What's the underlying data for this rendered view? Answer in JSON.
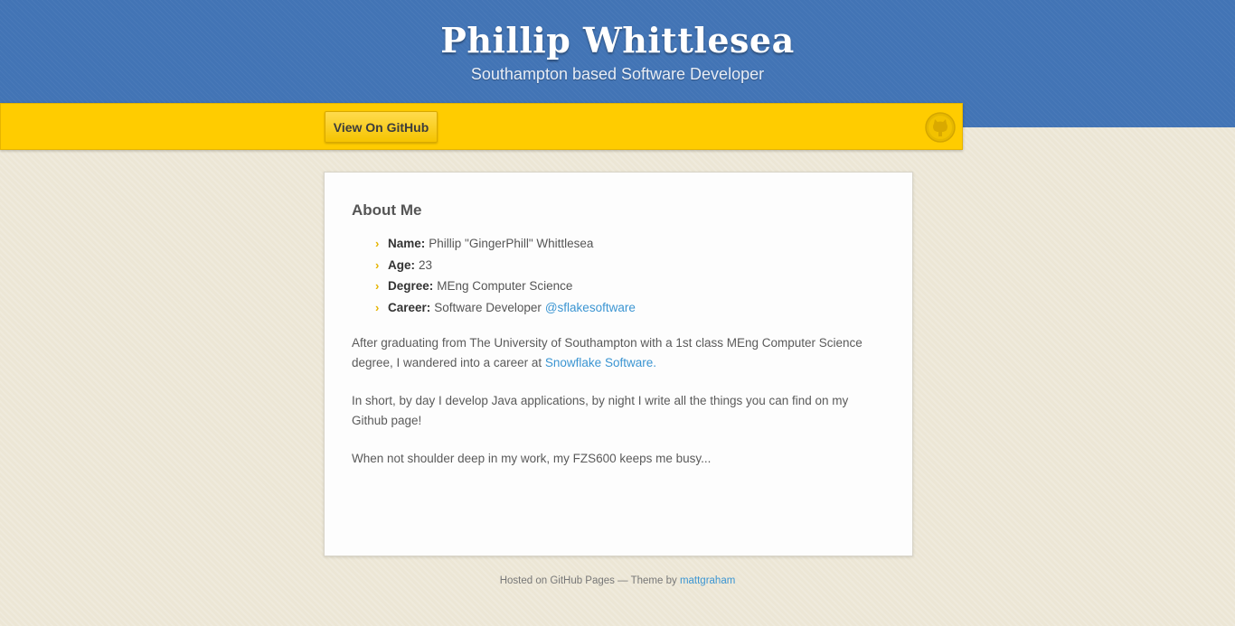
{
  "header": {
    "title": "Phillip Whittlesea",
    "subtitle": "Southampton based Software Developer"
  },
  "toolbar": {
    "github_button_label": "View On GitHub",
    "icon": "github-octocat-icon"
  },
  "about": {
    "heading": "About Me",
    "facts": [
      {
        "label": "Name:",
        "value": "Phillip \"GingerPhill\" Whittlesea"
      },
      {
        "label": "Age:",
        "value": "23"
      },
      {
        "label": "Degree:",
        "value": "MEng Computer Science"
      },
      {
        "label": "Career:",
        "value": "Software Developer",
        "link": "@sflakesoftware"
      }
    ],
    "paragraph1_text": "After graduating from The University of Southampton with a 1st class MEng Computer Science degree, I wandered into a career at",
    "paragraph1_link": "Snowflake Software.",
    "paragraph2": "In short, by day I develop Java applications, by night I write all the things you can find on my Github page!",
    "paragraph3": "When not shoulder deep in my work, my FZS600 keeps me busy..."
  },
  "footer": {
    "text": "Hosted on GitHub Pages — Theme by",
    "link": "mattgraham"
  },
  "colors": {
    "header_blue": "#4274b5",
    "toolbar_yellow": "#ffcc00",
    "link_blue": "#3b95d2",
    "background": "#ece6d5"
  }
}
